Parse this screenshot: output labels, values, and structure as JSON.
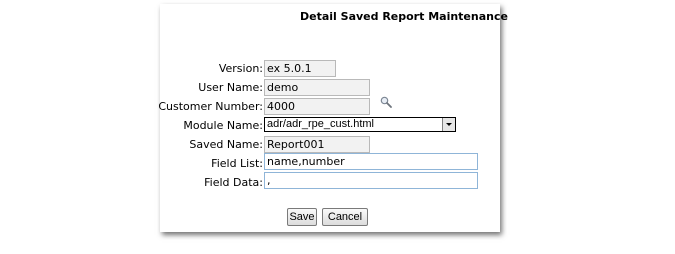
{
  "header": {
    "title": "Detail Saved Report Maintenance"
  },
  "form": {
    "version": {
      "label": "Version:",
      "value": "ex 5.0.1"
    },
    "user_name": {
      "label": "User Name:",
      "value": "demo"
    },
    "customer_number": {
      "label": "Customer Number:",
      "value": "4000",
      "lookup_icon": "magnifier-icon"
    },
    "module_name": {
      "label": "Module Name:",
      "value": "adr/adr_rpe_cust.html"
    },
    "saved_name": {
      "label": "Saved Name:",
      "value": "Report001"
    },
    "field_list": {
      "label": "Field List:",
      "value": "name,number"
    },
    "field_data": {
      "label": "Field Data:",
      "value": ","
    }
  },
  "actions": {
    "save_label": "Save",
    "cancel_label": "Cancel"
  }
}
